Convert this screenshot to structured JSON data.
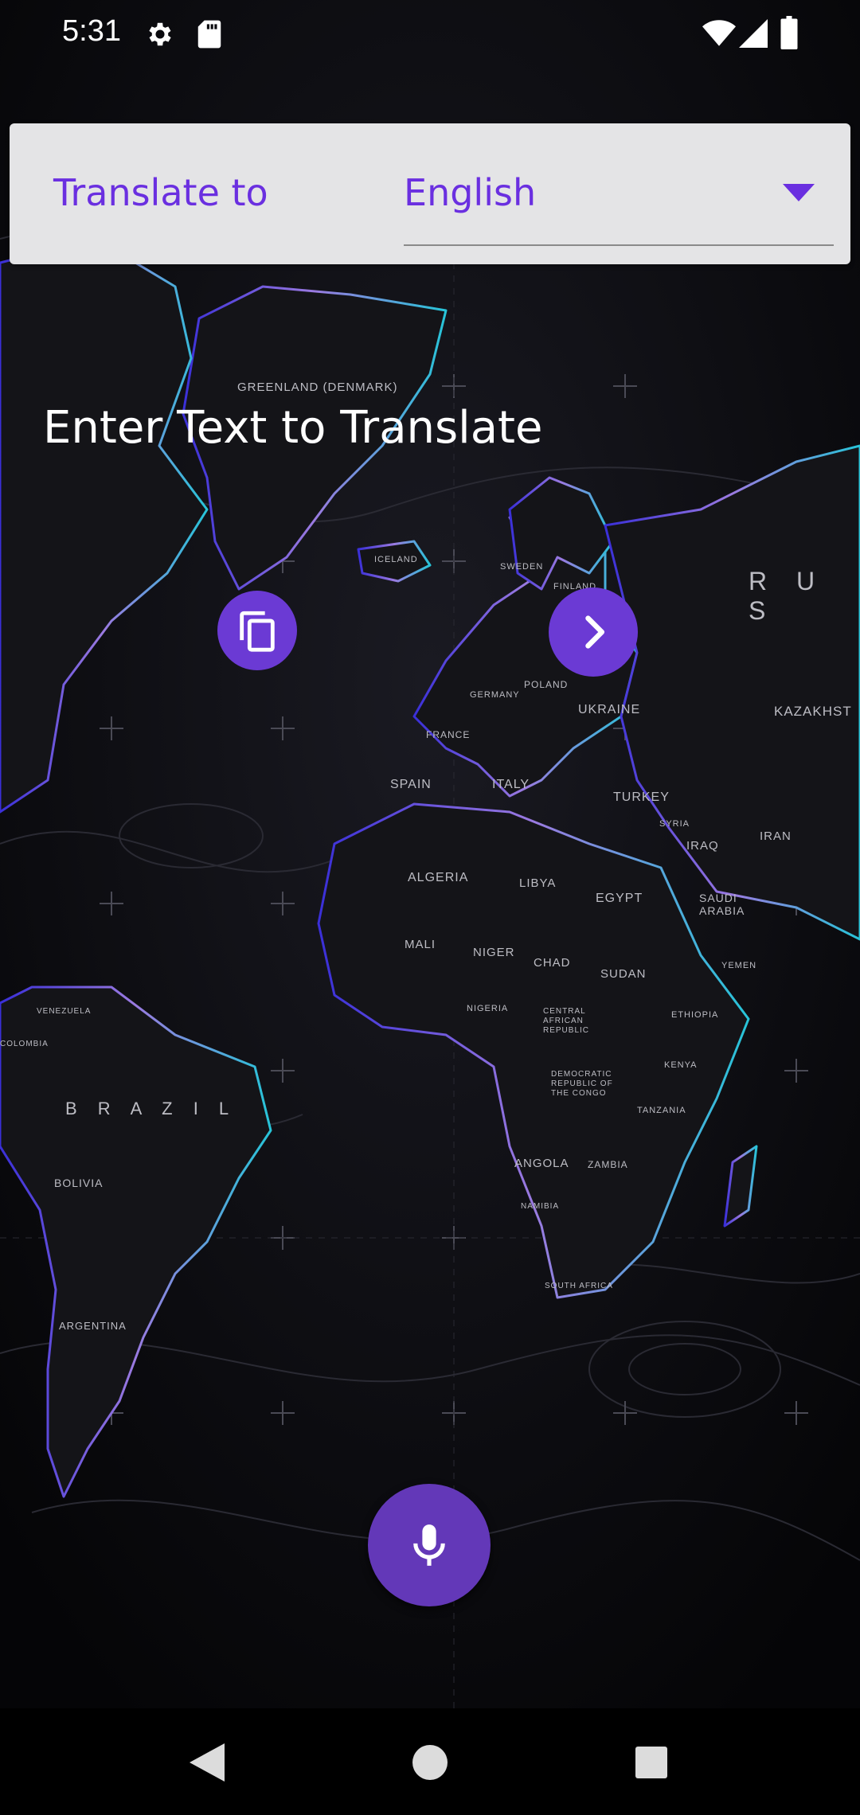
{
  "status_bar": {
    "time": "5:31",
    "icons": [
      "settings-icon",
      "sd-card-icon",
      "wifi-icon",
      "cellular-icon",
      "battery-icon"
    ]
  },
  "translate_bar": {
    "label": "Translate to",
    "selected_language": "English"
  },
  "input": {
    "placeholder": "Enter Text to Translate"
  },
  "actions": {
    "copy_icon": "copy-icon",
    "next_icon": "chevron-right-icon",
    "mic_icon": "mic-icon"
  },
  "map_labels": {
    "greenland": "GREENLAND (DENMARK)",
    "russia": "R U S",
    "kazakhstan": "KAZAKHST",
    "brazil": "B R A Z I L",
    "bolivia": "BOLIVIA",
    "argentina": "ARGENTINA",
    "algeria": "ALGERIA",
    "libya": "LIBYA",
    "egypt": "EGYPT",
    "mali": "MALI",
    "niger": "NIGER",
    "chad": "CHAD",
    "sudan": "SUDAN",
    "nigeria": "NIGERIA",
    "ethiopia": "ETHIOPIA",
    "kenya": "KENYA",
    "tanzania": "TANZANIA",
    "angola": "ANGOLA",
    "zambia": "ZAMBIA",
    "namibia": "NAMIBIA",
    "south_africa": "SOUTH AFRICA",
    "drc": "DEMOCRATIC REPUBLIC OF THE CONGO",
    "car": "CENTRAL AFRICAN REPUBLIC",
    "ukraine": "UKRAINE",
    "poland": "POLAND",
    "germany": "GERMANY",
    "france": "FRANCE",
    "spain": "SPAIN",
    "italy": "ITALY",
    "turkey": "TURKEY",
    "iraq": "IRAQ",
    "iran": "IRAN",
    "syria": "SYRIA",
    "saudi": "SAUDI ARABIA",
    "yemen": "YEMEN",
    "iceland": "ICELAND",
    "sweden": "SWEDEN",
    "finland": "FINLAND",
    "colombia": "COLOMBIA",
    "venezuela": "VENEZUELA"
  },
  "colors": {
    "accent": "#6a2fe0",
    "fab": "#6b3ad4",
    "card": "#e4e4e6"
  },
  "nav_bar": {
    "back": "back-icon",
    "home": "home-icon",
    "recents": "recents-icon"
  }
}
